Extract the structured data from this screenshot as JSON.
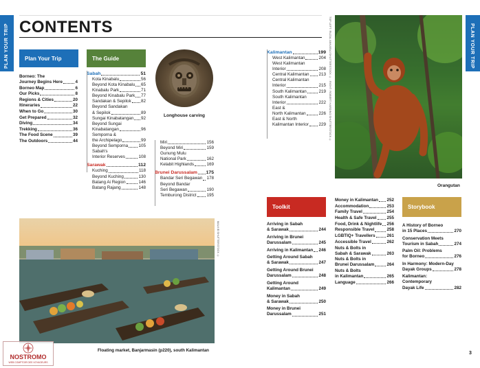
{
  "sidebar": {
    "label": "PLAN YOUR TRIP"
  },
  "page": {
    "title": "CONTENTS",
    "number": "3"
  },
  "plan": {
    "header": "Plan Your Trip",
    "items": [
      {
        "lines": [
          "Borneo: The",
          "Journey Begins Here"
        ],
        "page": "4"
      },
      {
        "lines": [
          "Borneo Map"
        ],
        "page": "6"
      },
      {
        "lines": [
          "Our Picks"
        ],
        "page": "8"
      },
      {
        "lines": [
          "Regions & Cities"
        ],
        "page": "20"
      },
      {
        "lines": [
          "Itineraries"
        ],
        "page": "22"
      },
      {
        "lines": [
          "When to Go"
        ],
        "page": "30"
      },
      {
        "lines": [
          "Get Prepared"
        ],
        "page": "32"
      },
      {
        "lines": [
          "Diving"
        ],
        "page": "34"
      },
      {
        "lines": [
          "Trekking"
        ],
        "page": "36"
      },
      {
        "lines": [
          "The Food Scene"
        ],
        "page": "39"
      },
      {
        "lines": [
          "The Outdoors"
        ],
        "page": "44"
      }
    ]
  },
  "guide": {
    "header": "The Guide",
    "sabah": {
      "name": "Sabah",
      "page": "51",
      "items": [
        {
          "lines": [
            "Kota Kinabalu"
          ],
          "page": "56"
        },
        {
          "lines": [
            "Beyond Kota Kinabalu"
          ],
          "page": "65"
        },
        {
          "lines": [
            "Kinabalu Park"
          ],
          "page": "71"
        },
        {
          "lines": [
            "Beyond Kinabalu Park"
          ],
          "page": "77"
        },
        {
          "lines": [
            "Sandakan & Sepilok"
          ],
          "page": "82"
        },
        {
          "lines": [
            "Beyond Sandakan",
            "& Sepilok"
          ],
          "page": "89"
        },
        {
          "lines": [
            "Sungai Kinabatangan"
          ],
          "page": "92"
        },
        {
          "lines": [
            "Beyond Sungai",
            "Kinabatangan"
          ],
          "page": "96"
        },
        {
          "lines": [
            "Semporna &",
            "the Archipelago"
          ],
          "page": "99"
        },
        {
          "lines": [
            "Beyond Semporna"
          ],
          "page": "105"
        },
        {
          "lines": [
            "Sabah's",
            "Interior Reserves"
          ],
          "page": "108"
        }
      ]
    },
    "sarawak": {
      "name": "Sarawak",
      "page": "112",
      "items": [
        {
          "lines": [
            "Kuching"
          ],
          "page": "118"
        },
        {
          "lines": [
            "Beyond Kuching"
          ],
          "page": "130"
        },
        {
          "lines": [
            "Batang Ai Region"
          ],
          "page": "146"
        },
        {
          "lines": [
            "Batang Rajang"
          ],
          "page": "148"
        }
      ]
    },
    "sarawak_cont": [
      {
        "lines": [
          "Miri"
        ],
        "page": "156"
      },
      {
        "lines": [
          "Beyond Miri"
        ],
        "page": "159"
      },
      {
        "lines": [
          "Gunung Mulu",
          "National Park"
        ],
        "page": "162"
      },
      {
        "lines": [
          "Kelabit Highlands"
        ],
        "page": "169"
      }
    ],
    "brunei": {
      "name": "Brunei Darussalam",
      "page": "175",
      "items": [
        {
          "lines": [
            "Bandar Seri Begawan"
          ],
          "page": "178"
        },
        {
          "lines": [
            "Beyond Bandar",
            "Seri Begawan"
          ],
          "page": "190"
        },
        {
          "lines": [
            "Temburong District"
          ],
          "page": "195"
        }
      ]
    },
    "kalimantan": {
      "name": "Kalimantan",
      "page": "199",
      "items": [
        {
          "lines": [
            "West Kalimantan"
          ],
          "page": "204"
        },
        {
          "lines": [
            "West Kalimantan",
            "Interior"
          ],
          "page": "208"
        },
        {
          "lines": [
            "Central Kalimantan"
          ],
          "page": "213"
        },
        {
          "lines": [
            "Central Kalimantan",
            "Interior"
          ],
          "page": "215"
        },
        {
          "lines": [
            "South Kalimantan"
          ],
          "page": "219"
        },
        {
          "lines": [
            "South Kalimantan",
            "Interior"
          ],
          "page": "222"
        },
        {
          "lines": [
            "East &",
            "North Kalimantan"
          ],
          "page": "226"
        },
        {
          "lines": [
            "East & North",
            "Kalimantan Interior"
          ],
          "page": "229"
        }
      ]
    }
  },
  "toolkit": {
    "header": "Toolkit",
    "col1": [
      {
        "lines": [
          "Arriving in Sabah",
          "& Sarawak"
        ],
        "page": "244"
      },
      {
        "lines": [
          "Arriving in Brunei",
          "Darussalam"
        ],
        "page": "245"
      },
      {
        "lines": [
          "Arriving in Kalimantan"
        ],
        "page": "246"
      },
      {
        "lines": [
          "Getting Around Sabah",
          "& Sarawak"
        ],
        "page": "247"
      },
      {
        "lines": [
          "Getting Around Brunei",
          "Darussalam"
        ],
        "page": "248"
      },
      {
        "lines": [
          "Getting Around",
          "Kalimantan"
        ],
        "page": "249"
      },
      {
        "lines": [
          "Money in Sabah",
          "& Sarawak"
        ],
        "page": "250"
      },
      {
        "lines": [
          "Money in Brunei",
          "Darussalam"
        ],
        "page": "251"
      }
    ],
    "col2": [
      {
        "lines": [
          "Money in Kalimantan"
        ],
        "page": "252"
      },
      {
        "lines": [
          "Accommodation"
        ],
        "page": "253"
      },
      {
        "lines": [
          "Family Travel"
        ],
        "page": "254"
      },
      {
        "lines": [
          "Health & Safe Travel"
        ],
        "page": "255"
      },
      {
        "lines": [
          "Food, Drink & Nightlife"
        ],
        "page": "256"
      },
      {
        "lines": [
          "Responsible Travel"
        ],
        "page": "258"
      },
      {
        "lines": [
          "LGBTIQ+ Travellers"
        ],
        "page": "261"
      },
      {
        "lines": [
          "Accessible Travel"
        ],
        "page": "262"
      },
      {
        "lines": [
          "Nuts & Bolts in",
          "Sabah & Sarawak"
        ],
        "page": "263"
      },
      {
        "lines": [
          "Nuts & Bolts in",
          "Brunei Darussalam"
        ],
        "page": "264"
      },
      {
        "lines": [
          "Nuts & Bolts",
          "in Kalimantan"
        ],
        "page": "265"
      },
      {
        "lines": [
          "Language"
        ],
        "page": "266"
      }
    ]
  },
  "storybook": {
    "header": "Storybook",
    "items": [
      {
        "lines": [
          "A History of Borneo",
          "in 15 Places"
        ],
        "page": "270"
      },
      {
        "lines": [
          "Conservation Meets",
          "Tourism in Sabah"
        ],
        "page": "274"
      },
      {
        "lines": [
          "Palm Oil: Problems",
          "for Borneo"
        ],
        "page": "276"
      },
      {
        "lines": [
          "In Harmony: Modern-Day",
          "Dayak Groups"
        ],
        "page": "278"
      },
      {
        "lines": [
          "Kalimantan:",
          "Contemporary",
          "Dayak Life"
        ],
        "page": "282"
      }
    ]
  },
  "captions": {
    "longhouse": "Longhouse carving",
    "orangutan": "Orangutan",
    "market": "Floating market, Banjarmasin (p220), south Kalimantan"
  },
  "credits": {
    "top": "TOP LEFT: RUZAL ANKARAJ/SHUTTERSTOCK © ; RIGHT: ROBERT HARDING/SHUTTERSTOCK ©",
    "market": "MALKIE/SHUTTERSTOCK ©"
  },
  "watermark": {
    "brand": "NOSTROMO",
    "tagline": "WEB COMPTOIR DES VOYAGEURS"
  },
  "colors": {
    "sidebar": "#1d6fb8",
    "plan": "#1d6fb8",
    "guide": "#56823a",
    "toolkit": "#c82a22",
    "storybook": "#c9a24a",
    "sabah": "#1d6fb8",
    "sarawak": "#c82a22",
    "kalimantan": "#1d6fb8"
  }
}
